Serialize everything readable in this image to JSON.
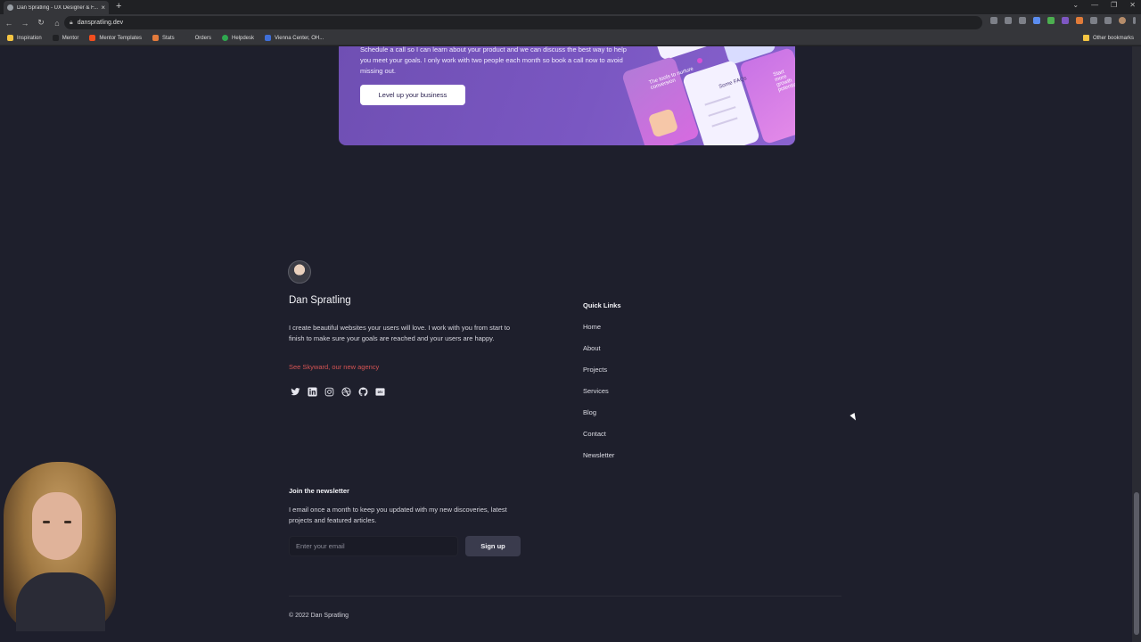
{
  "browser": {
    "tab_title": "Dan Spratling - UX Designer & F...",
    "tab_close": "×",
    "new_tab": "+",
    "url": "danspratling.dev",
    "bookmarks": [
      "Inspiration",
      "Mentor",
      "Mentor Templates",
      "Stats",
      "Orders",
      "Helpdesk",
      "Vienna Center, OH..."
    ],
    "other_bookmarks": "Other bookmarks"
  },
  "cta": {
    "text": "Schedule a call so I can learn about your product and we can discuss the best way to help you meet your goals. I only work with two people each month so book a call now to avoid missing out.",
    "button": "Level up your business",
    "mock_labels": [
      "The tools to nurture conversion",
      "Some FAQs",
      "Start more growth potential"
    ]
  },
  "profile": {
    "name": "Dan Spratling",
    "bio": "I create beautiful websites your users will love. I work with you from start to finish to make sure your goals are reached and your users are happy.",
    "agency_link": "See Skyward, our new agency",
    "socials": [
      "twitter-icon",
      "linkedin-icon",
      "instagram-icon",
      "dribbble-icon",
      "github-icon",
      "dev-icon"
    ]
  },
  "quick_links": {
    "title": "Quick Links",
    "items": [
      "Home",
      "About",
      "Projects",
      "Services",
      "Blog",
      "Contact",
      "Newsletter"
    ]
  },
  "newsletter": {
    "title": "Join the newsletter",
    "text": "I email once a month to keep you updated with my new discoveries, latest projects and featured articles.",
    "placeholder": "Enter your email",
    "button": "Sign up"
  },
  "footer": {
    "copyright": "© 2022 Dan Spratling"
  },
  "colors": {
    "page_bg": "#1e1f2c",
    "cta_purple": "#7a57c2",
    "agency_red": "#d45353"
  }
}
